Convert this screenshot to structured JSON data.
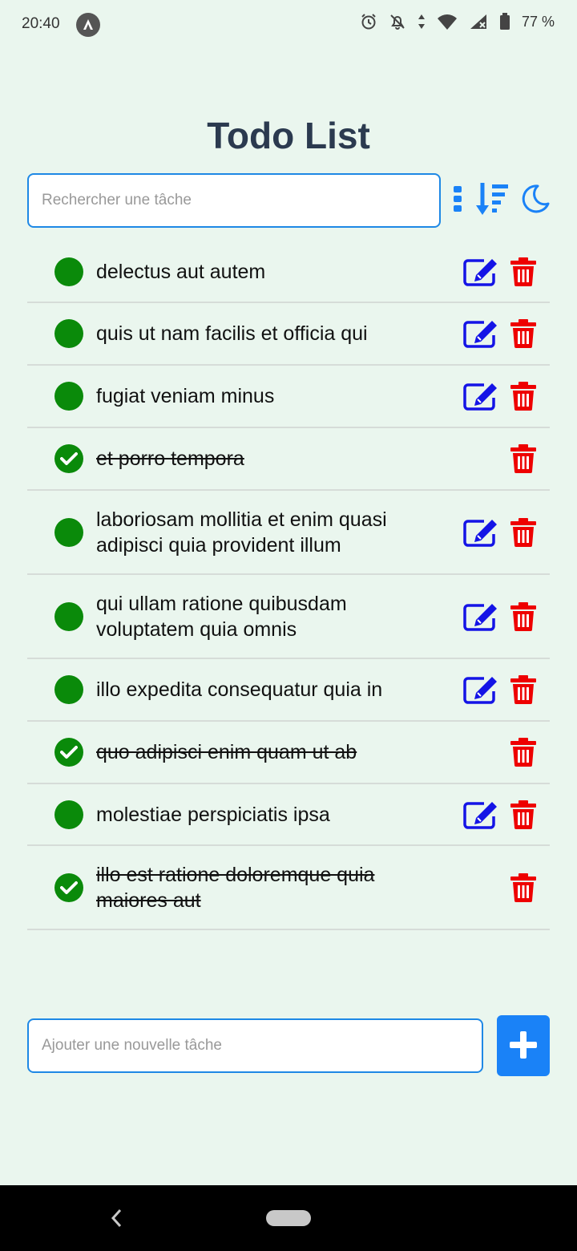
{
  "status_bar": {
    "time": "20:40",
    "battery": "77 %"
  },
  "header": {
    "title": "Todo List"
  },
  "search": {
    "placeholder": "Rechercher une tâche",
    "value": ""
  },
  "toolbar": {
    "icons": [
      "more-vertical-icon",
      "sort-icon",
      "moon-icon"
    ],
    "accent": "#1a82f7"
  },
  "todos": [
    {
      "text": "delectus aut autem",
      "completed": false
    },
    {
      "text": "quis ut nam facilis et officia qui",
      "completed": false
    },
    {
      "text": "fugiat veniam minus",
      "completed": false
    },
    {
      "text": "et porro tempora",
      "completed": true
    },
    {
      "text": "laboriosam mollitia et enim quasi adipisci quia provident illum",
      "completed": false
    },
    {
      "text": "qui ullam ratione quibusdam voluptatem quia omnis",
      "completed": false
    },
    {
      "text": "illo expedita consequatur quia in",
      "completed": false
    },
    {
      "text": "quo adipisci enim quam ut ab",
      "completed": true
    },
    {
      "text": "molestiae perspiciatis ipsa",
      "completed": false
    },
    {
      "text": "illo est ratione doloremque quia maiores aut",
      "completed": true
    }
  ],
  "colors": {
    "status_done": "#0a8a0a",
    "edit": "#1414e6",
    "delete": "#ee0000",
    "background": "#eaf6ee"
  },
  "add_task": {
    "placeholder": "Ajouter une nouvelle tâche",
    "value": ""
  }
}
